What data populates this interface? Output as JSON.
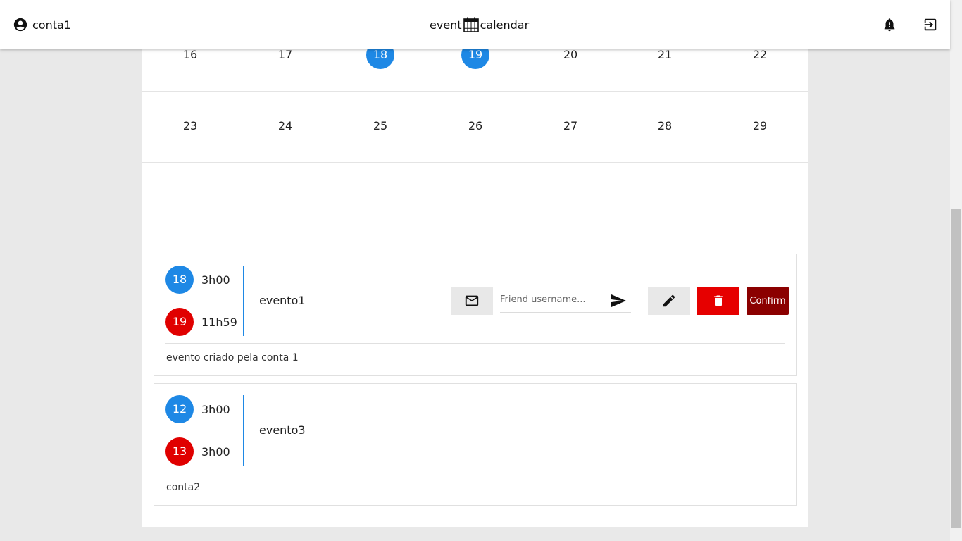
{
  "header": {
    "username": "conta1",
    "brand_left": "event",
    "brand_right": "calendar",
    "icons": [
      "account-circle-icon",
      "calendar-icon",
      "bell-icon",
      "logout-icon"
    ]
  },
  "calendar": {
    "weeks": [
      {
        "days": [
          {
            "label": "16",
            "selected": false
          },
          {
            "label": "17",
            "selected": false
          },
          {
            "label": "18",
            "selected": true
          },
          {
            "label": "19",
            "selected": true
          },
          {
            "label": "20",
            "selected": false
          },
          {
            "label": "21",
            "selected": false
          },
          {
            "label": "22",
            "selected": false
          }
        ]
      },
      {
        "days": [
          {
            "label": "23",
            "selected": false
          },
          {
            "label": "24",
            "selected": false
          },
          {
            "label": "25",
            "selected": false
          },
          {
            "label": "26",
            "selected": false
          },
          {
            "label": "27",
            "selected": false
          },
          {
            "label": "28",
            "selected": false
          },
          {
            "label": "29",
            "selected": false
          }
        ]
      }
    ],
    "selected_color": "#1e88e5"
  },
  "events": [
    {
      "start_day": "18",
      "start_time": "3h00",
      "end_day": "19",
      "end_time": "11h59",
      "name": "evento1",
      "description": "evento criado pela conta 1",
      "friend_placeholder": "Friend username...",
      "confirm_label": "Confirm",
      "owned": true
    },
    {
      "start_day": "12",
      "start_time": "3h00",
      "end_day": "13",
      "end_time": "3h00",
      "name": "evento3",
      "description": "conta2",
      "owned": false
    }
  ],
  "colors": {
    "start_dot": "#1e88e5",
    "end_dot": "#e00000",
    "delete_button": "#e60000",
    "confirm_button": "#8b0000"
  }
}
